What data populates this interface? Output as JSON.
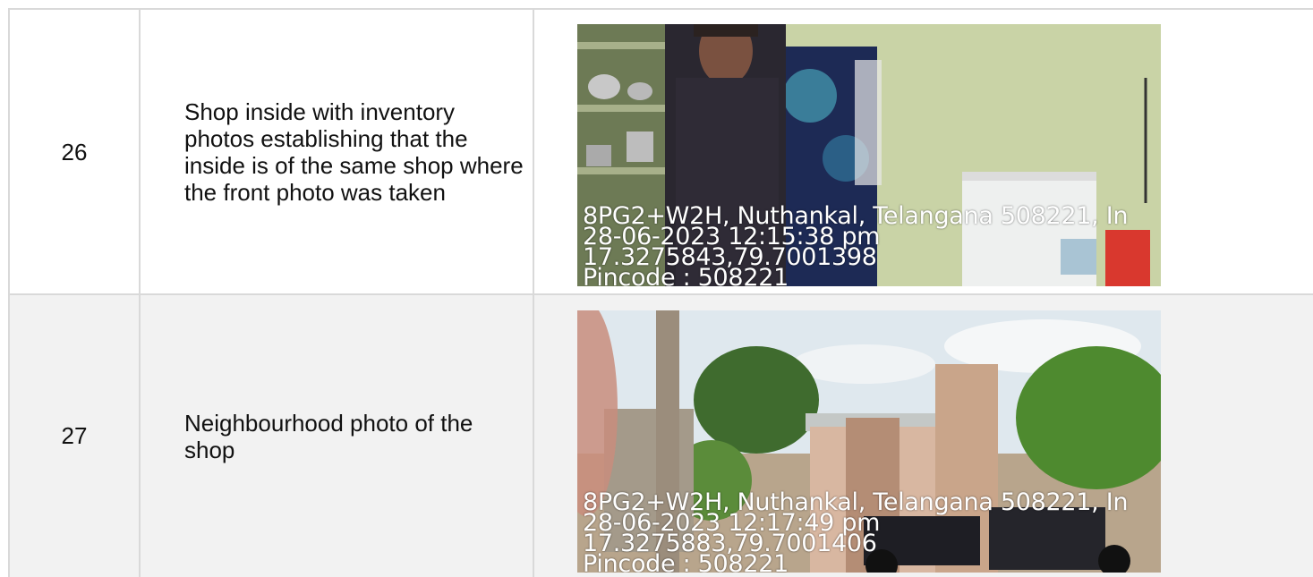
{
  "rows": [
    {
      "number": "26",
      "description": "Shop inside with inventory photos establishing that the inside is of the same shop where the front photo was taken",
      "geotag": {
        "address": "8PG2+W2H, Nuthankal, Telangana 508221, In",
        "datetime": "28-06-2023 12:15:38 pm",
        "coords": "17.3275843,79.7001398",
        "pincode": "Pincode : 508221"
      }
    },
    {
      "number": "27",
      "description": "Neighbourhood photo of the shop",
      "geotag": {
        "address": "8PG2+W2H, Nuthankal, Telangana 508221, In",
        "datetime": "28-06-2023 12:17:49 pm",
        "coords": "17.3275883,79.7001406",
        "pincode": "Pincode : 508221"
      }
    }
  ]
}
